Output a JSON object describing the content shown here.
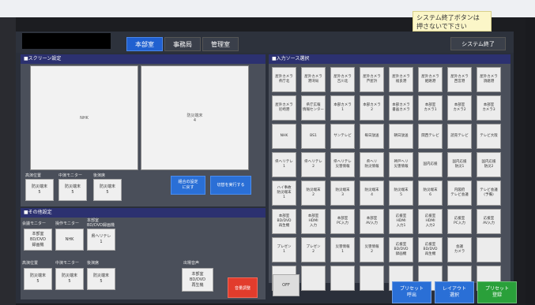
{
  "sticky_note": "システム終了ボタンは\n押さないで下さい",
  "tabs": [
    "本部室",
    "事務局",
    "管理室"
  ],
  "system_end": "システム終了",
  "screen_settings": {
    "header": "■スクリーン設定",
    "preview_left": "NHK",
    "preview_right": "防災端末\n4",
    "labels": [
      "高演位置",
      "中演モニター",
      "後演席"
    ],
    "buttons": [
      "防災端末\n5",
      "防災端末\n5",
      "防災端末\n5"
    ],
    "reset_label": "組合の設定\nに戻す",
    "apply_label": "切替を実行する"
  },
  "other_settings": {
    "header": "■その他設定",
    "row1_labels": [
      "会議モニター",
      "操作モニター",
      "本部室\nBD/DVD録画機"
    ],
    "row1_buttons": [
      "本部室\nBD/DVD\n録画機",
      "NHK",
      "県ヘリテレ\n1"
    ],
    "row2_labels": [
      "高演位置",
      "中演モニター",
      "後演席",
      "出場音声"
    ],
    "row2_buttons": [
      "防災端末\n5",
      "防災端末\n5",
      "防災端末\n5"
    ],
    "audio_button": "本部室\nBD/DVD\n再生機",
    "volume_button": "音量調整"
  },
  "sources": {
    "header": "■入力ソース選択",
    "rows": [
      [
        "屋外カメラ\n県庁北",
        "屋外カメラ\n港湾局",
        "屋外カメラ\n吉川北",
        "屋外カメラ\n芦屋浜",
        "屋外カメラ\n福良港",
        "屋外カメラ\n姫路港",
        "屋外カメラ\n西宮港",
        "屋外カメラ\n須磨港"
      ],
      [
        "屋外カメラ\n尼崎港",
        "県庁広報\n情報センター",
        "本部カメラ\n1",
        "本部カメラ\n2",
        "本部カメラ\n書画カメラ",
        "本部室\nカメラ1",
        "本部室\nカメラ2",
        "本部室\nカメラ3"
      ],
      [
        "NHK",
        "BS1",
        "サンテレビ",
        "毎日放送",
        "朝日放送",
        "関西テレビ",
        "読売テレビ",
        "テレビ大阪"
      ],
      [
        "県ヘリテレ\n1",
        "県ヘリテレ\n2",
        "県ヘリテレ\n災害情報",
        "県ヘリ\n防災情報",
        "神戸ヘリ\n災害情報",
        "国内応援",
        "国内応援\n防災1",
        "国内応援\n防災2"
      ],
      [
        "ハイ事故\n防災端末\n1",
        "防災端末\n2",
        "防災端末\n3",
        "防災端末\n4",
        "防災端末\n5",
        "防災端末\n6",
        "内閣府\nテレビ会議",
        "テレビ会議\n(予備)"
      ],
      [
        "本部室\nBD/DVD\n再生機",
        "本部室\nHDMI\n入力",
        "本部室\nPC入力",
        "本部室\nAV入力",
        "応援室\nHDMI\n入力1",
        "応援室\nHDMI\n入力2",
        "応援室\nPC入力",
        "応援室\nAV入力"
      ],
      [
        "プレゼン\n1",
        "プレゼン\n2",
        "災害情報\n1",
        "災害情報\n2",
        "応援室\nBD/DVD\n録画機",
        "応援室\nBD/DVD\n再生機",
        "会議\nカメラ",
        ""
      ],
      [
        "",
        "",
        "",
        "",
        "",
        "",
        "",
        ""
      ]
    ],
    "off_button": "OFF",
    "preset_call": "プリセット\n呼出",
    "layout_select": "レイアウト\n選択",
    "preset_save": "プリセット\n登録"
  },
  "colors": {
    "active_tab": "#2060d0",
    "panel_header": "#2c3170",
    "blue_button": "#2a6fd6",
    "red_button": "#e23c2c",
    "green_button": "#2aa03a"
  }
}
